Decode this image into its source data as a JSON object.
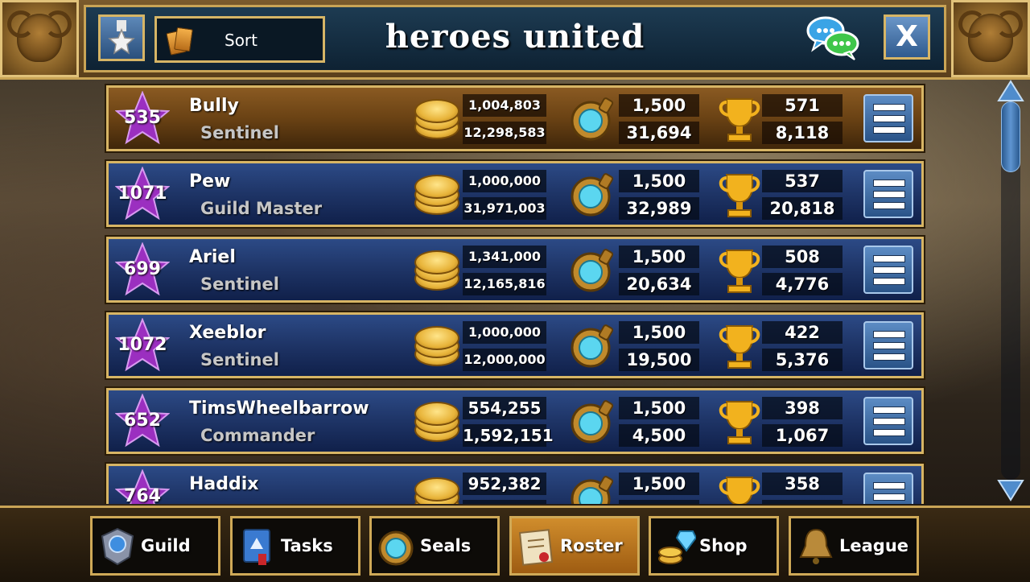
{
  "header": {
    "title": "heroes united",
    "sort_label": "Sort",
    "close_label": "X"
  },
  "rows": [
    {
      "level": "535",
      "name": "Bully",
      "rank": "Sentinel",
      "gold_top": "1,004,803",
      "gold_bottom": "12,298,583",
      "seal_top": "1,500",
      "seal_bottom": "31,694",
      "trophy_top": "571",
      "trophy_bottom": "8,118"
    },
    {
      "level": "1071",
      "name": "Pew",
      "rank": "Guild Master",
      "gold_top": "1,000,000",
      "gold_bottom": "31,971,003",
      "seal_top": "1,500",
      "seal_bottom": "32,989",
      "trophy_top": "537",
      "trophy_bottom": "20,818"
    },
    {
      "level": "699",
      "name": "Ariel",
      "rank": "Sentinel",
      "gold_top": "1,341,000",
      "gold_bottom": "12,165,816",
      "seal_top": "1,500",
      "seal_bottom": "20,634",
      "trophy_top": "508",
      "trophy_bottom": "4,776"
    },
    {
      "level": "1072",
      "name": "Xeeblor",
      "rank": "Sentinel",
      "gold_top": "1,000,000",
      "gold_bottom": "12,000,000",
      "seal_top": "1,500",
      "seal_bottom": "19,500",
      "trophy_top": "422",
      "trophy_bottom": "5,376"
    },
    {
      "level": "652",
      "name": "TimsWheelbarrow",
      "rank": "Commander",
      "gold_top": "554,255",
      "gold_bottom": "1,592,151",
      "seal_top": "1,500",
      "seal_bottom": "4,500",
      "trophy_top": "398",
      "trophy_bottom": "1,067"
    },
    {
      "level": "764",
      "name": "Haddix",
      "rank": "",
      "gold_top": "952,382",
      "gold_bottom": "",
      "seal_top": "1,500",
      "seal_bottom": "",
      "trophy_top": "358",
      "trophy_bottom": ""
    }
  ],
  "nav": [
    {
      "label": "Guild",
      "icon": "guild-icon"
    },
    {
      "label": "Tasks",
      "icon": "tasks-icon"
    },
    {
      "label": "Seals",
      "icon": "seals-icon"
    },
    {
      "label": "Roster",
      "icon": "roster-icon"
    },
    {
      "label": "Shop",
      "icon": "shop-icon"
    },
    {
      "label": "League",
      "icon": "league-icon"
    }
  ],
  "active_nav": "Roster",
  "colors": {
    "accent_gold": "#d7b565",
    "row_blue": "#1e3466",
    "row_highlight": "#6a4214",
    "level_star": "#9b2fc0"
  }
}
